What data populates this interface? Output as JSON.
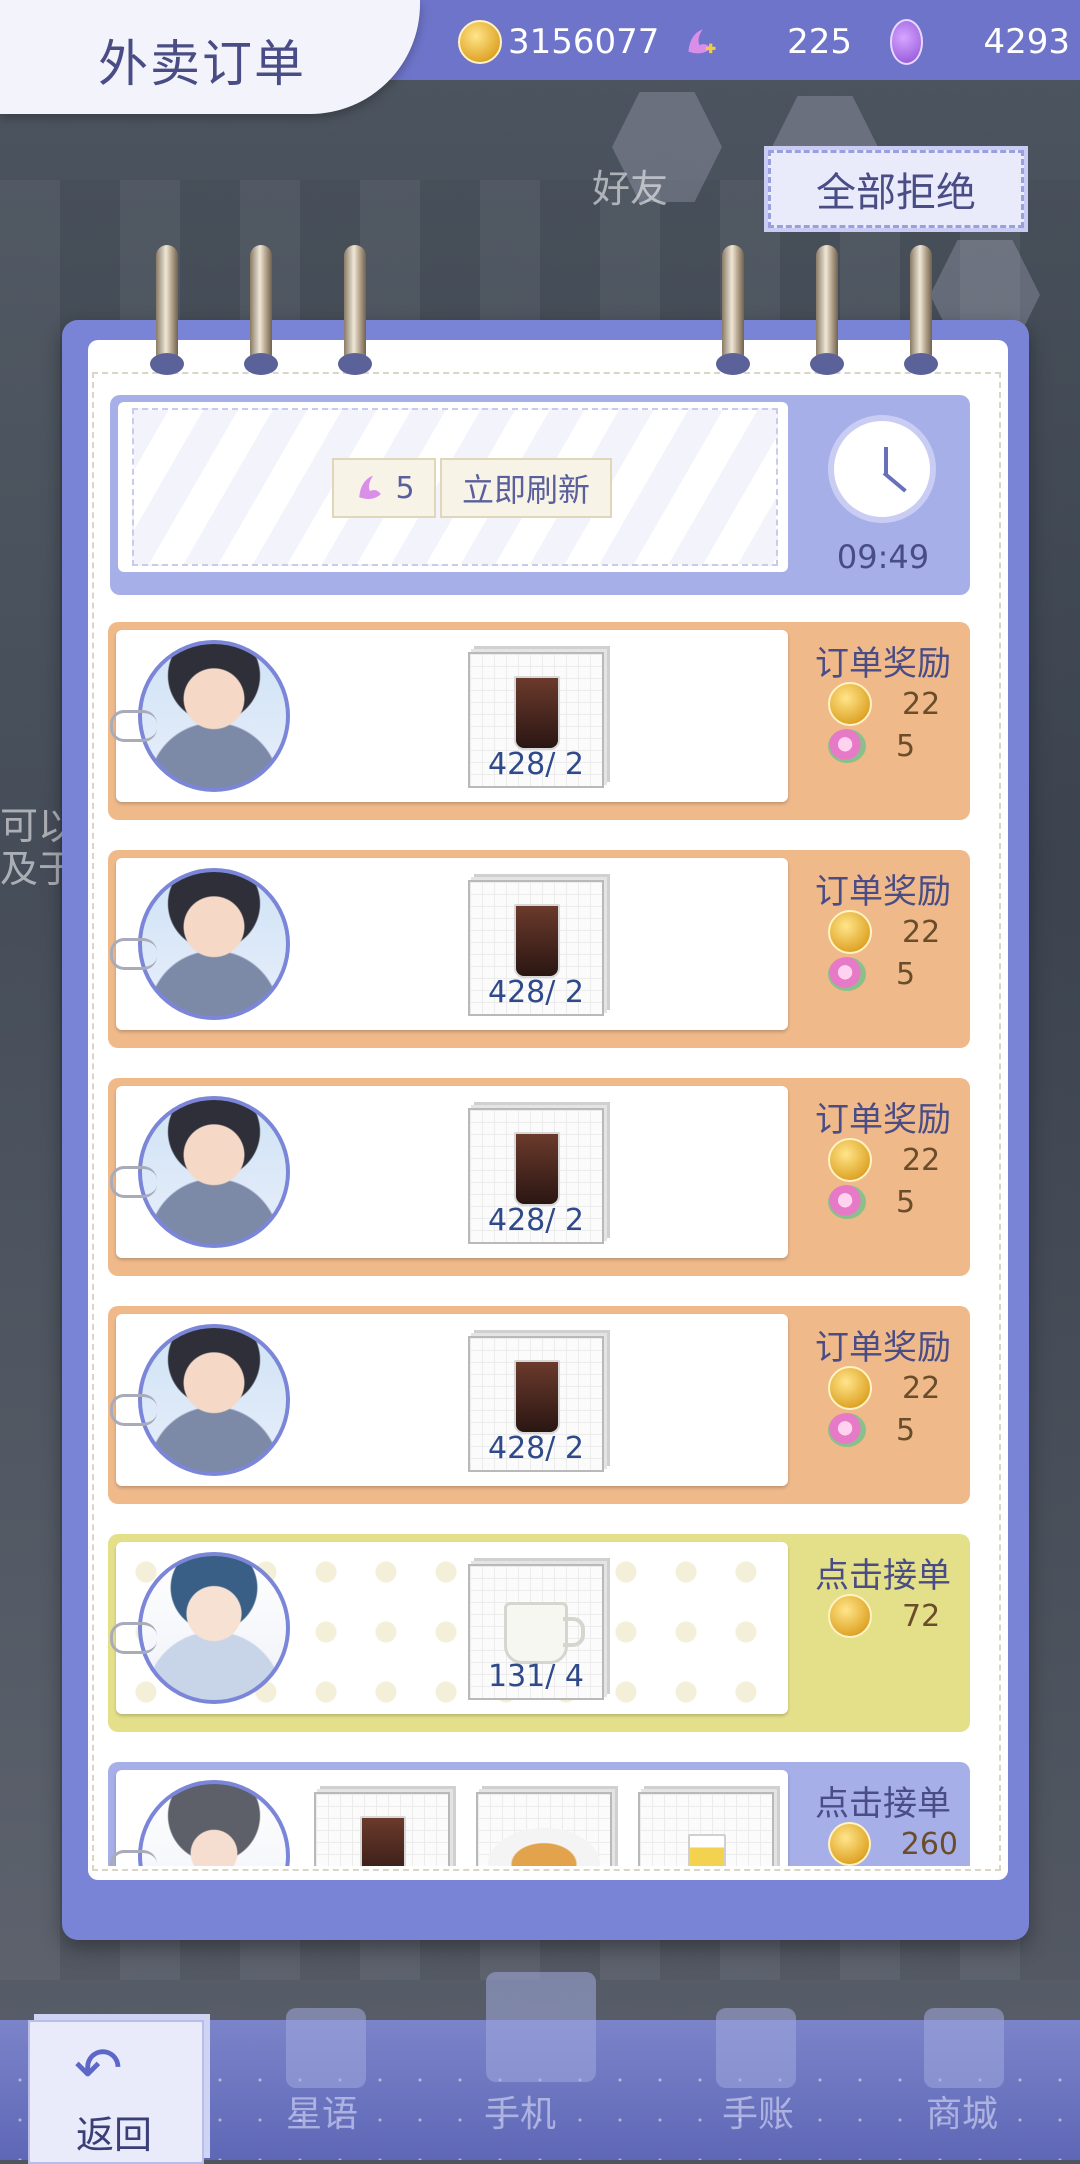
{
  "header": {
    "title": "外卖订单"
  },
  "resources": {
    "gold": "3156077",
    "swan": "225",
    "moon": "4293"
  },
  "background": {
    "friends_label": "好友",
    "left_text_1": "可以",
    "left_text_2": "及于"
  },
  "actions": {
    "refuse_all": "全部拒绝"
  },
  "refresh": {
    "cost": "5",
    "label": "立即刷新",
    "timer": "09:49"
  },
  "orders": [
    {
      "reward_title": "订单奖励",
      "item_qty": "428/ 2",
      "gold": "22",
      "flower": "5"
    },
    {
      "reward_title": "订单奖励",
      "item_qty": "428/ 2",
      "gold": "22",
      "flower": "5"
    },
    {
      "reward_title": "订单奖励",
      "item_qty": "428/ 2",
      "gold": "22",
      "flower": "5"
    },
    {
      "reward_title": "订单奖励",
      "item_qty": "428/ 2",
      "gold": "22",
      "flower": "5"
    },
    {
      "reward_title": "点击接单",
      "item_qty": "131/ 4",
      "gold": "72"
    },
    {
      "reward_title": "点击接单",
      "gold": "260"
    }
  ],
  "nav": {
    "back": "返回",
    "stars": "星语",
    "phone": "手机",
    "journal": "手账",
    "shop": "商城"
  }
}
